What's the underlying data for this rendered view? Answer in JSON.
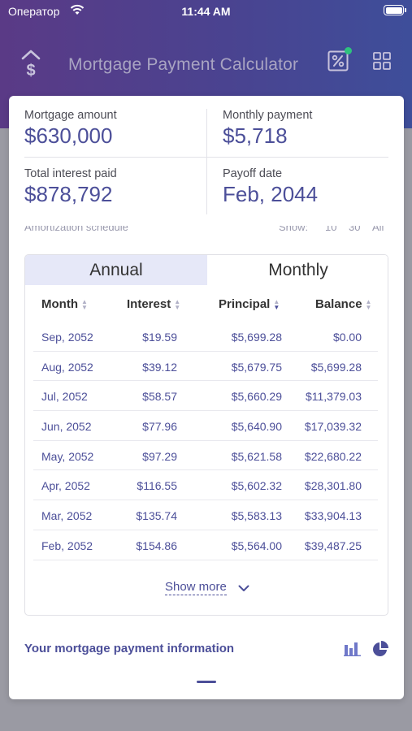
{
  "status_bar": {
    "carrier": "Оператор",
    "time": "11:44 AM"
  },
  "header": {
    "title": "Mortgage Payment Calculator"
  },
  "summary": {
    "mortgage_amount": {
      "label": "Mortgage amount",
      "value": "$630,000"
    },
    "monthly_payment": {
      "label": "Monthly payment",
      "value": "$5,718"
    },
    "total_interest": {
      "label": "Total interest paid",
      "value": "$878,792"
    },
    "payoff_date": {
      "label": "Payoff date",
      "value": "Feb, 2044"
    }
  },
  "schedule": {
    "title": "Amortization schedule",
    "show_label": "Show:",
    "show_options": [
      "10",
      "30",
      "All"
    ]
  },
  "table": {
    "tabs": [
      "Annual",
      "Monthly"
    ],
    "active_tab": "Annual",
    "columns": [
      "Month",
      "Interest",
      "Principal",
      "Balance"
    ],
    "rows": [
      [
        "Sep, 2052",
        "$19.59",
        "$5,699.28",
        "$0.00"
      ],
      [
        "Aug, 2052",
        "$39.12",
        "$5,679.75",
        "$5,699.28"
      ],
      [
        "Jul, 2052",
        "$58.57",
        "$5,660.29",
        "$11,379.03"
      ],
      [
        "Jun, 2052",
        "$77.96",
        "$5,640.90",
        "$17,039.32"
      ],
      [
        "May, 2052",
        "$97.29",
        "$5,621.58",
        "$22,680.22"
      ],
      [
        "Apr, 2052",
        "$116.55",
        "$5,602.32",
        "$28,301.80"
      ],
      [
        "Mar, 2052",
        "$135.74",
        "$5,583.13",
        "$33,904.13"
      ],
      [
        "Feb, 2052",
        "$154.86",
        "$5,564.00",
        "$39,487.25"
      ]
    ],
    "show_more": "Show more"
  },
  "info": {
    "title": "Your mortgage payment information"
  },
  "colors": {
    "accent": "#4c4f99",
    "header_start": "#5a3a86",
    "header_end": "#3e4e9a",
    "notification": "#2ec27e"
  }
}
